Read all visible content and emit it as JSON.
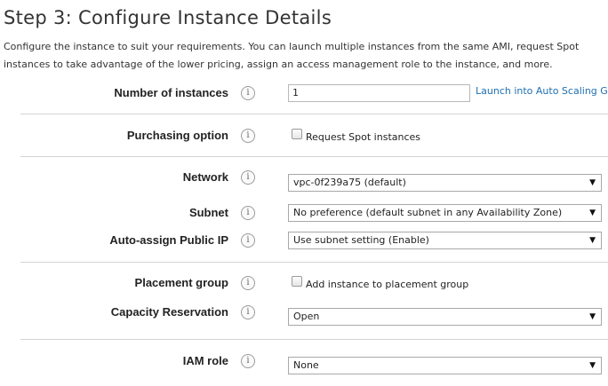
{
  "page": {
    "title": "Step 3: Configure Instance Details",
    "description": "Configure the instance to suit your requirements. You can launch multiple instances from the same AMI, request Spot instances to take advantage of the lower pricing, assign an access management role to the instance, and more."
  },
  "icons": {
    "info": "i"
  },
  "fields": {
    "number_of_instances": {
      "label": "Number of instances",
      "value": "1",
      "link": "Launch into Auto Scaling Group"
    },
    "purchasing_option": {
      "label": "Purchasing option",
      "checkbox_label": "Request Spot instances",
      "checked": false
    },
    "network": {
      "label": "Network",
      "value": "vpc-0f239a75 (default)"
    },
    "subnet": {
      "label": "Subnet",
      "value": "No preference (default subnet in any Availability Zone)"
    },
    "auto_assign_public_ip": {
      "label": "Auto-assign Public IP",
      "value": "Use subnet setting (Enable)"
    },
    "placement_group": {
      "label": "Placement group",
      "checkbox_label": "Add instance to placement group",
      "checked": false
    },
    "capacity_reservation": {
      "label": "Capacity Reservation",
      "value": "Open"
    },
    "iam_role": {
      "label": "IAM role",
      "value": "None"
    }
  }
}
